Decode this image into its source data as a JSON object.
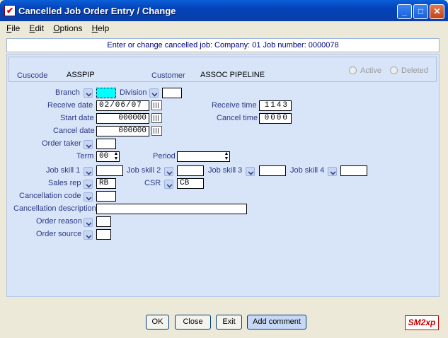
{
  "window": {
    "title": "Cancelled Job Order Entry / Change",
    "app_icon_glyph": "✔"
  },
  "menu": [
    "File",
    "Edit",
    "Options",
    "Help"
  ],
  "header": {
    "text": "Enter or change cancelled job:  Company:  01   Job number:  0000078"
  },
  "cuscode": {
    "label": "Cuscode",
    "value": "ASSPIP"
  },
  "customer": {
    "label": "Customer",
    "value": "ASSOC PIPELINE"
  },
  "status": {
    "active": "Active",
    "deleted": "Deleted"
  },
  "form": {
    "branch": {
      "label": "Branch",
      "value": ""
    },
    "division": {
      "label": "Division",
      "value": ""
    },
    "receive_date": {
      "label": "Receive date",
      "value": "02/06/07"
    },
    "receive_time": {
      "label": "Receive time",
      "value": "1143"
    },
    "start_date": {
      "label": "Start date",
      "value": "000000"
    },
    "cancel_time": {
      "label": "Cancel time",
      "value": "0000"
    },
    "cancel_date": {
      "label": "Cancel date",
      "value": "000000"
    },
    "order_taker": {
      "label": "Order taker",
      "value": ""
    },
    "term": {
      "label": "Term",
      "value": "00"
    },
    "period": {
      "label": "Period",
      "value": ""
    },
    "job_skill_1": {
      "label": "Job skill 1",
      "value": ""
    },
    "job_skill_2": {
      "label": "Job skill 2",
      "value": ""
    },
    "job_skill_3": {
      "label": "Job skill 3",
      "value": ""
    },
    "job_skill_4": {
      "label": "Job skill 4",
      "value": ""
    },
    "sales_rep": {
      "label": "Sales rep",
      "value": "RB"
    },
    "csr": {
      "label": "CSR",
      "value": "CB"
    },
    "cancellation_code": {
      "label": "Cancellation code",
      "value": ""
    },
    "cancellation_description": {
      "label": "Cancellation description",
      "value": ""
    },
    "order_reason": {
      "label": "Order reason",
      "value": ""
    },
    "order_source": {
      "label": "Order source",
      "value": ""
    }
  },
  "buttons": {
    "ok": "OK",
    "close": "Close",
    "exit": "Exit",
    "add_comment": "Add comment"
  },
  "logo": {
    "text": "SM2xp"
  },
  "colors": {
    "label": "#2a3a86",
    "panel": "#d8e4f8",
    "titlebar": "#0a4fc8",
    "branch_highlight": "#00ffff"
  }
}
